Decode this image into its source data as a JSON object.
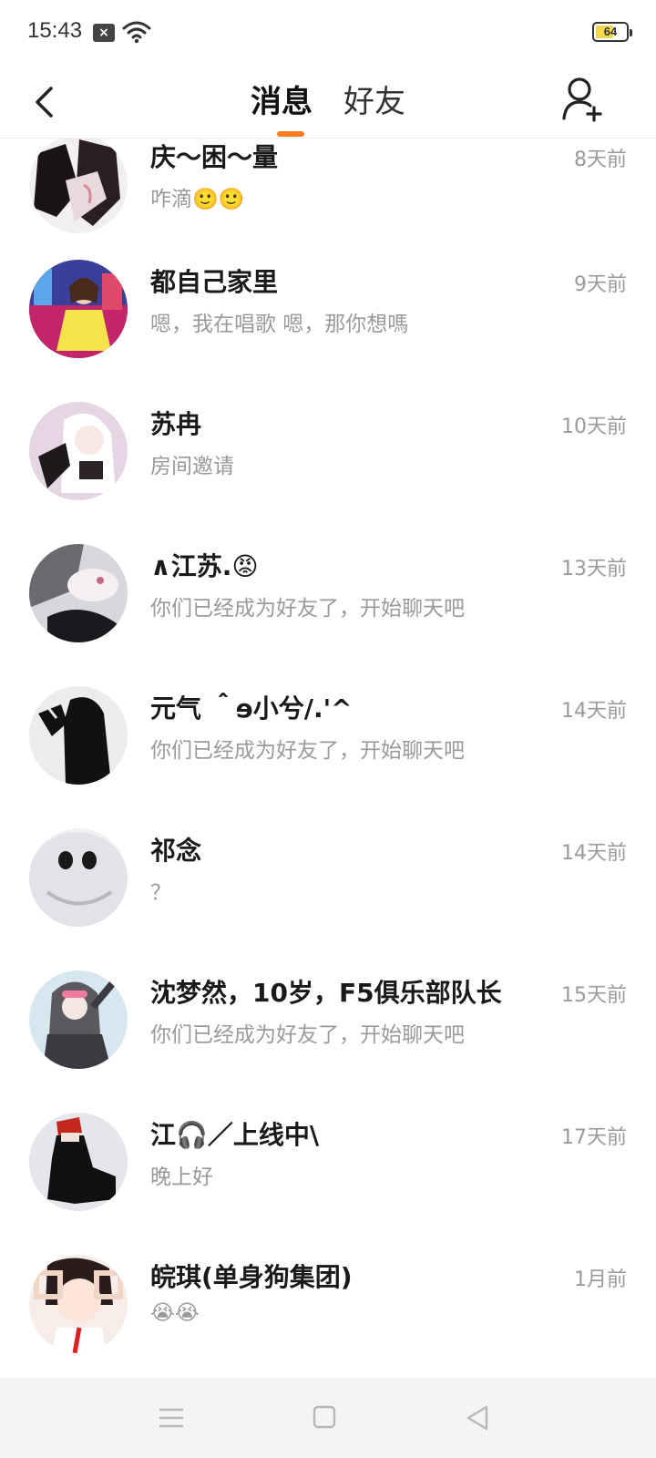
{
  "status_bar": {
    "time": "15:43",
    "notification_icon": "close-x-badge-icon",
    "wifi_icon": "wifi-icon",
    "battery_level": "64",
    "battery_fraction": 0.64,
    "battery_color": "#f3d84a"
  },
  "header": {
    "back_icon": "chevron-left-icon",
    "tabs": [
      {
        "label": "消息",
        "active": true
      },
      {
        "label": "好友",
        "active": false
      }
    ],
    "indicator_color": "#ff7a1a",
    "add_friend_icon": "add-user-icon"
  },
  "conversations": [
    {
      "name": "庆～困～量",
      "preview": "咋滴🙂🙂",
      "time": "8天前",
      "avatar": "avatar-dark-sketch"
    },
    {
      "name": "都自己家里",
      "preview": "嗯，我在唱歌 嗯，那你想嗎",
      "time": "9天前",
      "avatar": "avatar-colorful-city-girl"
    },
    {
      "name": "苏冉",
      "preview": "房间邀请",
      "time": "10天前",
      "avatar": "avatar-white-hair-girl"
    },
    {
      "name": "∧江苏.😡",
      "preview": "你们已经成为好友了，开始聊天吧",
      "time": "13天前",
      "avatar": "avatar-grey-sketch"
    },
    {
      "name": "元气 ＾ɘ小兮/.'^",
      "preview": "你们已经成为好友了，开始聊天吧",
      "time": "14天前",
      "avatar": "avatar-black-hair-silhouette"
    },
    {
      "name": "祁念",
      "preview": "？",
      "time": "14天前",
      "avatar": "avatar-hooded-face"
    },
    {
      "name": "沈梦然，10岁，F5俱乐部队长",
      "preview": "你们已经成为好友了，开始聊天吧",
      "time": "15天前",
      "avatar": "avatar-sunglasses-girl"
    },
    {
      "name": "江🎧／上线中\\",
      "preview": "晚上好",
      "time": "17天前",
      "avatar": "avatar-sitting-figure"
    },
    {
      "name": "皖琪(单身狗集团)",
      "preview": "😭😭",
      "time": "1月前",
      "avatar": "avatar-photo-frame-girl"
    }
  ],
  "nav_bar": {
    "menu_icon": "menu-icon",
    "home_icon": "square-home-icon",
    "back_icon": "triangle-back-icon"
  }
}
